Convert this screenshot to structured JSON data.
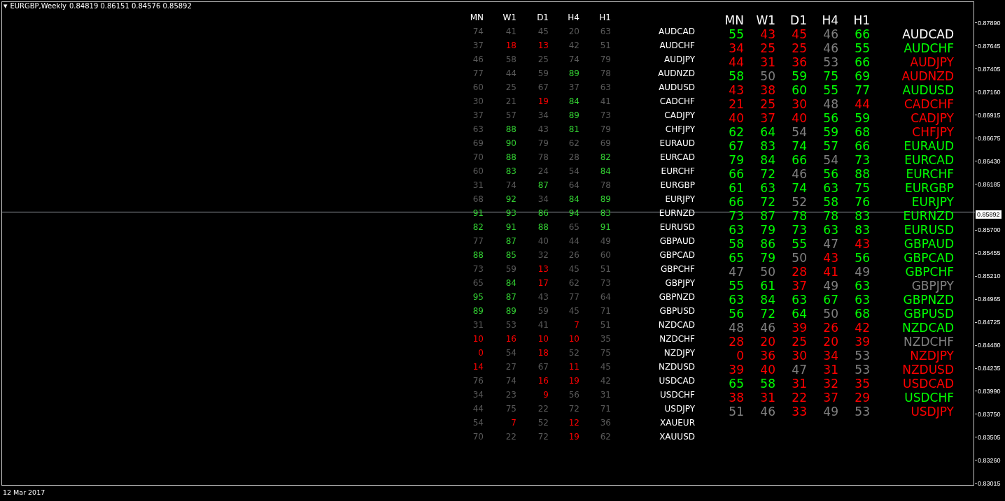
{
  "chart": {
    "menu_glyph": "▼",
    "title": "EURGBP,Weekly",
    "ohlc": "0.84819 0.86151 0.84576 0.85892"
  },
  "price_axis": [
    {
      "kind": "tick",
      "text": "0.87890"
    },
    {
      "kind": "tick",
      "text": "0.87645"
    },
    {
      "kind": "tick",
      "text": "0.87405"
    },
    {
      "kind": "tick",
      "text": "0.87160"
    },
    {
      "kind": "tick",
      "text": "0.86915"
    },
    {
      "kind": "tick",
      "text": "0.86675"
    },
    {
      "kind": "tick",
      "text": "0.86430"
    },
    {
      "kind": "tick",
      "text": "0.86185"
    },
    {
      "kind": "current",
      "text": "0.85892"
    },
    {
      "kind": "tick",
      "text": "0.85700"
    },
    {
      "kind": "tick",
      "text": "0.85455"
    },
    {
      "kind": "tick",
      "text": "0.85210"
    },
    {
      "kind": "tick",
      "text": "0.84965"
    },
    {
      "kind": "tick",
      "text": "0.84725"
    },
    {
      "kind": "tick",
      "text": "0.84480"
    },
    {
      "kind": "tick",
      "text": "0.84235"
    },
    {
      "kind": "tick",
      "text": "0.83990"
    },
    {
      "kind": "tick",
      "text": "0.83750"
    },
    {
      "kind": "tick",
      "text": "0.83505"
    },
    {
      "kind": "tick",
      "text": "0.83260"
    },
    {
      "kind": "tick",
      "text": "0.83015"
    }
  ],
  "time_axis": [
    "12 Mar 2017"
  ],
  "tables": [
    {
      "kind": "small",
      "columns": [
        "MN",
        "W1",
        "D1",
        "H4",
        "H1"
      ],
      "rows": [
        {
          "cells": [
            {
              "text": "74",
              "color": "#5a5a5a"
            },
            {
              "text": "41",
              "color": "#5a5a5a"
            },
            {
              "text": "45",
              "color": "#5a5a5a"
            },
            {
              "text": "20",
              "color": "#5a5a5a"
            },
            {
              "text": "63",
              "color": "#5a5a5a"
            }
          ],
          "symbol": {
            "text": "AUDCAD",
            "color": "#ffffff"
          }
        },
        {
          "cells": [
            {
              "text": "37",
              "color": "#5a5a5a"
            },
            {
              "text": "18",
              "color": "#ff0000"
            },
            {
              "text": "13",
              "color": "#ff0000"
            },
            {
              "text": "42",
              "color": "#5a5a5a"
            },
            {
              "text": "51",
              "color": "#5a5a5a"
            }
          ],
          "symbol": {
            "text": "AUDCHF",
            "color": "#ffffff"
          }
        },
        {
          "cells": [
            {
              "text": "46",
              "color": "#5a5a5a"
            },
            {
              "text": "58",
              "color": "#5a5a5a"
            },
            {
              "text": "25",
              "color": "#5a5a5a"
            },
            {
              "text": "74",
              "color": "#5a5a5a"
            },
            {
              "text": "79",
              "color": "#5a5a5a"
            }
          ],
          "symbol": {
            "text": "AUDJPY",
            "color": "#ffffff"
          }
        },
        {
          "cells": [
            {
              "text": "77",
              "color": "#5a5a5a"
            },
            {
              "text": "44",
              "color": "#5a5a5a"
            },
            {
              "text": "59",
              "color": "#5a5a5a"
            },
            {
              "text": "89",
              "color": "#32cd32"
            },
            {
              "text": "78",
              "color": "#5a5a5a"
            }
          ],
          "symbol": {
            "text": "AUDNZD",
            "color": "#ffffff"
          }
        },
        {
          "cells": [
            {
              "text": "60",
              "color": "#5a5a5a"
            },
            {
              "text": "25",
              "color": "#5a5a5a"
            },
            {
              "text": "67",
              "color": "#5a5a5a"
            },
            {
              "text": "37",
              "color": "#5a5a5a"
            },
            {
              "text": "63",
              "color": "#5a5a5a"
            }
          ],
          "symbol": {
            "text": "AUDUSD",
            "color": "#ffffff"
          }
        },
        {
          "cells": [
            {
              "text": "30",
              "color": "#5a5a5a"
            },
            {
              "text": "21",
              "color": "#5a5a5a"
            },
            {
              "text": "19",
              "color": "#ff0000"
            },
            {
              "text": "84",
              "color": "#32cd32"
            },
            {
              "text": "41",
              "color": "#5a5a5a"
            }
          ],
          "symbol": {
            "text": "CADCHF",
            "color": "#ffffff"
          }
        },
        {
          "cells": [
            {
              "text": "37",
              "color": "#5a5a5a"
            },
            {
              "text": "57",
              "color": "#5a5a5a"
            },
            {
              "text": "34",
              "color": "#5a5a5a"
            },
            {
              "text": "89",
              "color": "#32cd32"
            },
            {
              "text": "73",
              "color": "#5a5a5a"
            }
          ],
          "symbol": {
            "text": "CADJPY",
            "color": "#ffffff"
          }
        },
        {
          "cells": [
            {
              "text": "63",
              "color": "#5a5a5a"
            },
            {
              "text": "88",
              "color": "#32cd32"
            },
            {
              "text": "43",
              "color": "#5a5a5a"
            },
            {
              "text": "81",
              "color": "#32cd32"
            },
            {
              "text": "79",
              "color": "#5a5a5a"
            }
          ],
          "symbol": {
            "text": "CHFJPY",
            "color": "#ffffff"
          }
        },
        {
          "cells": [
            {
              "text": "69",
              "color": "#5a5a5a"
            },
            {
              "text": "90",
              "color": "#32cd32"
            },
            {
              "text": "79",
              "color": "#5a5a5a"
            },
            {
              "text": "62",
              "color": "#5a5a5a"
            },
            {
              "text": "69",
              "color": "#5a5a5a"
            }
          ],
          "symbol": {
            "text": "EURAUD",
            "color": "#ffffff"
          }
        },
        {
          "cells": [
            {
              "text": "70",
              "color": "#5a5a5a"
            },
            {
              "text": "88",
              "color": "#32cd32"
            },
            {
              "text": "78",
              "color": "#5a5a5a"
            },
            {
              "text": "28",
              "color": "#5a5a5a"
            },
            {
              "text": "82",
              "color": "#32cd32"
            }
          ],
          "symbol": {
            "text": "EURCAD",
            "color": "#ffffff"
          }
        },
        {
          "cells": [
            {
              "text": "60",
              "color": "#5a5a5a"
            },
            {
              "text": "83",
              "color": "#32cd32"
            },
            {
              "text": "24",
              "color": "#5a5a5a"
            },
            {
              "text": "54",
              "color": "#5a5a5a"
            },
            {
              "text": "84",
              "color": "#32cd32"
            }
          ],
          "symbol": {
            "text": "EURCHF",
            "color": "#ffffff"
          }
        },
        {
          "cells": [
            {
              "text": "31",
              "color": "#5a5a5a"
            },
            {
              "text": "74",
              "color": "#5a5a5a"
            },
            {
              "text": "87",
              "color": "#32cd32"
            },
            {
              "text": "64",
              "color": "#5a5a5a"
            },
            {
              "text": "78",
              "color": "#5a5a5a"
            }
          ],
          "symbol": {
            "text": "EURGBP",
            "color": "#ffffff"
          }
        },
        {
          "cells": [
            {
              "text": "68",
              "color": "#5a5a5a"
            },
            {
              "text": "92",
              "color": "#32cd32"
            },
            {
              "text": "34",
              "color": "#5a5a5a"
            },
            {
              "text": "84",
              "color": "#32cd32"
            },
            {
              "text": "89",
              "color": "#32cd32"
            }
          ],
          "symbol": {
            "text": "EURJPY",
            "color": "#ffffff"
          }
        },
        {
          "cells": [
            {
              "text": "91",
              "color": "#32cd32"
            },
            {
              "text": "93",
              "color": "#32cd32"
            },
            {
              "text": "86",
              "color": "#32cd32"
            },
            {
              "text": "94",
              "color": "#32cd32"
            },
            {
              "text": "83",
              "color": "#32cd32"
            }
          ],
          "symbol": {
            "text": "EURNZD",
            "color": "#ffffff"
          }
        },
        {
          "cells": [
            {
              "text": "82",
              "color": "#32cd32"
            },
            {
              "text": "91",
              "color": "#32cd32"
            },
            {
              "text": "88",
              "color": "#32cd32"
            },
            {
              "text": "65",
              "color": "#5a5a5a"
            },
            {
              "text": "91",
              "color": "#32cd32"
            }
          ],
          "symbol": {
            "text": "EURUSD",
            "color": "#ffffff"
          }
        },
        {
          "cells": [
            {
              "text": "77",
              "color": "#5a5a5a"
            },
            {
              "text": "87",
              "color": "#32cd32"
            },
            {
              "text": "40",
              "color": "#5a5a5a"
            },
            {
              "text": "44",
              "color": "#5a5a5a"
            },
            {
              "text": "49",
              "color": "#5a5a5a"
            }
          ],
          "symbol": {
            "text": "GBPAUD",
            "color": "#ffffff"
          }
        },
        {
          "cells": [
            {
              "text": "88",
              "color": "#32cd32"
            },
            {
              "text": "85",
              "color": "#32cd32"
            },
            {
              "text": "32",
              "color": "#5a5a5a"
            },
            {
              "text": "26",
              "color": "#5a5a5a"
            },
            {
              "text": "60",
              "color": "#5a5a5a"
            }
          ],
          "symbol": {
            "text": "GBPCAD",
            "color": "#ffffff"
          }
        },
        {
          "cells": [
            {
              "text": "73",
              "color": "#5a5a5a"
            },
            {
              "text": "59",
              "color": "#5a5a5a"
            },
            {
              "text": "13",
              "color": "#ff0000"
            },
            {
              "text": "45",
              "color": "#5a5a5a"
            },
            {
              "text": "51",
              "color": "#5a5a5a"
            }
          ],
          "symbol": {
            "text": "GBPCHF",
            "color": "#ffffff"
          }
        },
        {
          "cells": [
            {
              "text": "65",
              "color": "#5a5a5a"
            },
            {
              "text": "84",
              "color": "#32cd32"
            },
            {
              "text": "17",
              "color": "#ff0000"
            },
            {
              "text": "62",
              "color": "#5a5a5a"
            },
            {
              "text": "73",
              "color": "#5a5a5a"
            }
          ],
          "symbol": {
            "text": "GBPJPY",
            "color": "#ffffff"
          }
        },
        {
          "cells": [
            {
              "text": "95",
              "color": "#32cd32"
            },
            {
              "text": "87",
              "color": "#32cd32"
            },
            {
              "text": "43",
              "color": "#5a5a5a"
            },
            {
              "text": "77",
              "color": "#5a5a5a"
            },
            {
              "text": "64",
              "color": "#5a5a5a"
            }
          ],
          "symbol": {
            "text": "GBPNZD",
            "color": "#ffffff"
          }
        },
        {
          "cells": [
            {
              "text": "89",
              "color": "#32cd32"
            },
            {
              "text": "89",
              "color": "#32cd32"
            },
            {
              "text": "59",
              "color": "#5a5a5a"
            },
            {
              "text": "45",
              "color": "#5a5a5a"
            },
            {
              "text": "71",
              "color": "#5a5a5a"
            }
          ],
          "symbol": {
            "text": "GBPUSD",
            "color": "#ffffff"
          }
        },
        {
          "cells": [
            {
              "text": "31",
              "color": "#5a5a5a"
            },
            {
              "text": "53",
              "color": "#5a5a5a"
            },
            {
              "text": "41",
              "color": "#5a5a5a"
            },
            {
              "text": "7",
              "color": "#ff0000"
            },
            {
              "text": "51",
              "color": "#5a5a5a"
            }
          ],
          "symbol": {
            "text": "NZDCAD",
            "color": "#ffffff"
          }
        },
        {
          "cells": [
            {
              "text": "10",
              "color": "#ff0000"
            },
            {
              "text": "16",
              "color": "#ff0000"
            },
            {
              "text": "10",
              "color": "#ff0000"
            },
            {
              "text": "10",
              "color": "#ff0000"
            },
            {
              "text": "35",
              "color": "#5a5a5a"
            }
          ],
          "symbol": {
            "text": "NZDCHF",
            "color": "#ffffff"
          }
        },
        {
          "cells": [
            {
              "text": "0",
              "color": "#ff0000"
            },
            {
              "text": "54",
              "color": "#5a5a5a"
            },
            {
              "text": "18",
              "color": "#ff0000"
            },
            {
              "text": "52",
              "color": "#5a5a5a"
            },
            {
              "text": "75",
              "color": "#5a5a5a"
            }
          ],
          "symbol": {
            "text": "NZDJPY",
            "color": "#ffffff"
          }
        },
        {
          "cells": [
            {
              "text": "14",
              "color": "#ff0000"
            },
            {
              "text": "27",
              "color": "#5a5a5a"
            },
            {
              "text": "67",
              "color": "#5a5a5a"
            },
            {
              "text": "11",
              "color": "#ff0000"
            },
            {
              "text": "45",
              "color": "#5a5a5a"
            }
          ],
          "symbol": {
            "text": "NZDUSD",
            "color": "#ffffff"
          }
        },
        {
          "cells": [
            {
              "text": "76",
              "color": "#5a5a5a"
            },
            {
              "text": "74",
              "color": "#5a5a5a"
            },
            {
              "text": "16",
              "color": "#ff0000"
            },
            {
              "text": "19",
              "color": "#ff0000"
            },
            {
              "text": "42",
              "color": "#5a5a5a"
            }
          ],
          "symbol": {
            "text": "USDCAD",
            "color": "#ffffff"
          }
        },
        {
          "cells": [
            {
              "text": "34",
              "color": "#5a5a5a"
            },
            {
              "text": "23",
              "color": "#5a5a5a"
            },
            {
              "text": "9",
              "color": "#ff0000"
            },
            {
              "text": "56",
              "color": "#5a5a5a"
            },
            {
              "text": "31",
              "color": "#5a5a5a"
            }
          ],
          "symbol": {
            "text": "USDCHF",
            "color": "#ffffff"
          }
        },
        {
          "cells": [
            {
              "text": "44",
              "color": "#5a5a5a"
            },
            {
              "text": "75",
              "color": "#5a5a5a"
            },
            {
              "text": "22",
              "color": "#5a5a5a"
            },
            {
              "text": "72",
              "color": "#5a5a5a"
            },
            {
              "text": "71",
              "color": "#5a5a5a"
            }
          ],
          "symbol": {
            "text": "USDJPY",
            "color": "#ffffff"
          }
        },
        {
          "cells": [
            {
              "text": "54",
              "color": "#5a5a5a"
            },
            {
              "text": "7",
              "color": "#ff0000"
            },
            {
              "text": "52",
              "color": "#5a5a5a"
            },
            {
              "text": "12",
              "color": "#ff0000"
            },
            {
              "text": "36",
              "color": "#5a5a5a"
            }
          ],
          "symbol": {
            "text": "XAUEUR",
            "color": "#ffffff"
          }
        },
        {
          "cells": [
            {
              "text": "70",
              "color": "#5a5a5a"
            },
            {
              "text": "22",
              "color": "#5a5a5a"
            },
            {
              "text": "72",
              "color": "#5a5a5a"
            },
            {
              "text": "19",
              "color": "#ff0000"
            },
            {
              "text": "62",
              "color": "#5a5a5a"
            }
          ],
          "symbol": {
            "text": "XAUUSD",
            "color": "#ffffff"
          }
        }
      ]
    },
    {
      "kind": "large",
      "columns": [
        "MN",
        "W1",
        "D1",
        "H4",
        "H1"
      ],
      "rows": [
        {
          "cells": [
            {
              "text": "55",
              "color": "#00ff00"
            },
            {
              "text": "43",
              "color": "#ff0000"
            },
            {
              "text": "45",
              "color": "#ff0000"
            },
            {
              "text": "46",
              "color": "#808080"
            },
            {
              "text": "66",
              "color": "#00ff00"
            }
          ],
          "symbol": {
            "text": "AUDCAD",
            "color": "#ffffff"
          }
        },
        {
          "cells": [
            {
              "text": "34",
              "color": "#ff0000"
            },
            {
              "text": "25",
              "color": "#ff0000"
            },
            {
              "text": "25",
              "color": "#ff0000"
            },
            {
              "text": "46",
              "color": "#808080"
            },
            {
              "text": "55",
              "color": "#00ff00"
            }
          ],
          "symbol": {
            "text": "AUDCHF",
            "color": "#00ff00"
          }
        },
        {
          "cells": [
            {
              "text": "44",
              "color": "#ff0000"
            },
            {
              "text": "31",
              "color": "#ff0000"
            },
            {
              "text": "36",
              "color": "#ff0000"
            },
            {
              "text": "53",
              "color": "#808080"
            },
            {
              "text": "66",
              "color": "#00ff00"
            }
          ],
          "symbol": {
            "text": "AUDJPY",
            "color": "#ff0000"
          }
        },
        {
          "cells": [
            {
              "text": "58",
              "color": "#00ff00"
            },
            {
              "text": "50",
              "color": "#808080"
            },
            {
              "text": "59",
              "color": "#00ff00"
            },
            {
              "text": "75",
              "color": "#00ff00"
            },
            {
              "text": "69",
              "color": "#00ff00"
            }
          ],
          "symbol": {
            "text": "AUDNZD",
            "color": "#ff0000"
          }
        },
        {
          "cells": [
            {
              "text": "43",
              "color": "#ff0000"
            },
            {
              "text": "38",
              "color": "#ff0000"
            },
            {
              "text": "60",
              "color": "#00ff00"
            },
            {
              "text": "55",
              "color": "#00ff00"
            },
            {
              "text": "77",
              "color": "#00ff00"
            }
          ],
          "symbol": {
            "text": "AUDUSD",
            "color": "#00ff00"
          }
        },
        {
          "cells": [
            {
              "text": "21",
              "color": "#ff0000"
            },
            {
              "text": "25",
              "color": "#ff0000"
            },
            {
              "text": "30",
              "color": "#ff0000"
            },
            {
              "text": "48",
              "color": "#808080"
            },
            {
              "text": "44",
              "color": "#ff0000"
            }
          ],
          "symbol": {
            "text": "CADCHF",
            "color": "#ff0000"
          }
        },
        {
          "cells": [
            {
              "text": "40",
              "color": "#ff0000"
            },
            {
              "text": "37",
              "color": "#ff0000"
            },
            {
              "text": "40",
              "color": "#ff0000"
            },
            {
              "text": "56",
              "color": "#00ff00"
            },
            {
              "text": "59",
              "color": "#00ff00"
            }
          ],
          "symbol": {
            "text": "CADJPY",
            "color": "#ff0000"
          }
        },
        {
          "cells": [
            {
              "text": "62",
              "color": "#00ff00"
            },
            {
              "text": "64",
              "color": "#00ff00"
            },
            {
              "text": "54",
              "color": "#808080"
            },
            {
              "text": "59",
              "color": "#00ff00"
            },
            {
              "text": "68",
              "color": "#00ff00"
            }
          ],
          "symbol": {
            "text": "CHFJPY",
            "color": "#ff0000"
          }
        },
        {
          "cells": [
            {
              "text": "67",
              "color": "#00ff00"
            },
            {
              "text": "83",
              "color": "#00ff00"
            },
            {
              "text": "74",
              "color": "#00ff00"
            },
            {
              "text": "57",
              "color": "#00ff00"
            },
            {
              "text": "66",
              "color": "#00ff00"
            }
          ],
          "symbol": {
            "text": "EURAUD",
            "color": "#00ff00"
          }
        },
        {
          "cells": [
            {
              "text": "79",
              "color": "#00ff00"
            },
            {
              "text": "84",
              "color": "#00ff00"
            },
            {
              "text": "66",
              "color": "#00ff00"
            },
            {
              "text": "54",
              "color": "#808080"
            },
            {
              "text": "73",
              "color": "#00ff00"
            }
          ],
          "symbol": {
            "text": "EURCAD",
            "color": "#00ff00"
          }
        },
        {
          "cells": [
            {
              "text": "66",
              "color": "#00ff00"
            },
            {
              "text": "72",
              "color": "#00ff00"
            },
            {
              "text": "46",
              "color": "#808080"
            },
            {
              "text": "56",
              "color": "#00ff00"
            },
            {
              "text": "88",
              "color": "#00ff00"
            }
          ],
          "symbol": {
            "text": "EURCHF",
            "color": "#00ff00"
          }
        },
        {
          "cells": [
            {
              "text": "61",
              "color": "#00ff00"
            },
            {
              "text": "63",
              "color": "#00ff00"
            },
            {
              "text": "74",
              "color": "#00ff00"
            },
            {
              "text": "63",
              "color": "#00ff00"
            },
            {
              "text": "75",
              "color": "#00ff00"
            }
          ],
          "symbol": {
            "text": "EURGBP",
            "color": "#00ff00"
          }
        },
        {
          "cells": [
            {
              "text": "66",
              "color": "#00ff00"
            },
            {
              "text": "72",
              "color": "#00ff00"
            },
            {
              "text": "52",
              "color": "#808080"
            },
            {
              "text": "58",
              "color": "#00ff00"
            },
            {
              "text": "76",
              "color": "#00ff00"
            }
          ],
          "symbol": {
            "text": "EURJPY",
            "color": "#00ff00"
          }
        },
        {
          "cells": [
            {
              "text": "73",
              "color": "#00ff00"
            },
            {
              "text": "87",
              "color": "#00ff00"
            },
            {
              "text": "78",
              "color": "#00ff00"
            },
            {
              "text": "78",
              "color": "#00ff00"
            },
            {
              "text": "83",
              "color": "#00ff00"
            }
          ],
          "symbol": {
            "text": "EURNZD",
            "color": "#00ff00"
          }
        },
        {
          "cells": [
            {
              "text": "63",
              "color": "#00ff00"
            },
            {
              "text": "79",
              "color": "#00ff00"
            },
            {
              "text": "73",
              "color": "#00ff00"
            },
            {
              "text": "63",
              "color": "#00ff00"
            },
            {
              "text": "83",
              "color": "#00ff00"
            }
          ],
          "symbol": {
            "text": "EURUSD",
            "color": "#00ff00"
          }
        },
        {
          "cells": [
            {
              "text": "58",
              "color": "#00ff00"
            },
            {
              "text": "86",
              "color": "#00ff00"
            },
            {
              "text": "55",
              "color": "#00ff00"
            },
            {
              "text": "47",
              "color": "#808080"
            },
            {
              "text": "43",
              "color": "#ff0000"
            }
          ],
          "symbol": {
            "text": "GBPAUD",
            "color": "#00ff00"
          }
        },
        {
          "cells": [
            {
              "text": "65",
              "color": "#00ff00"
            },
            {
              "text": "79",
              "color": "#00ff00"
            },
            {
              "text": "50",
              "color": "#808080"
            },
            {
              "text": "43",
              "color": "#ff0000"
            },
            {
              "text": "56",
              "color": "#00ff00"
            }
          ],
          "symbol": {
            "text": "GBPCAD",
            "color": "#00ff00"
          }
        },
        {
          "cells": [
            {
              "text": "47",
              "color": "#808080"
            },
            {
              "text": "50",
              "color": "#808080"
            },
            {
              "text": "28",
              "color": "#ff0000"
            },
            {
              "text": "41",
              "color": "#ff0000"
            },
            {
              "text": "49",
              "color": "#808080"
            }
          ],
          "symbol": {
            "text": "GBPCHF",
            "color": "#00ff00"
          }
        },
        {
          "cells": [
            {
              "text": "55",
              "color": "#00ff00"
            },
            {
              "text": "61",
              "color": "#00ff00"
            },
            {
              "text": "37",
              "color": "#ff0000"
            },
            {
              "text": "49",
              "color": "#808080"
            },
            {
              "text": "63",
              "color": "#00ff00"
            }
          ],
          "symbol": {
            "text": "GBPJPY",
            "color": "#808080"
          }
        },
        {
          "cells": [
            {
              "text": "63",
              "color": "#00ff00"
            },
            {
              "text": "84",
              "color": "#00ff00"
            },
            {
              "text": "63",
              "color": "#00ff00"
            },
            {
              "text": "67",
              "color": "#00ff00"
            },
            {
              "text": "63",
              "color": "#00ff00"
            }
          ],
          "symbol": {
            "text": "GBPNZD",
            "color": "#00ff00"
          }
        },
        {
          "cells": [
            {
              "text": "56",
              "color": "#00ff00"
            },
            {
              "text": "72",
              "color": "#00ff00"
            },
            {
              "text": "64",
              "color": "#00ff00"
            },
            {
              "text": "50",
              "color": "#808080"
            },
            {
              "text": "68",
              "color": "#00ff00"
            }
          ],
          "symbol": {
            "text": "GBPUSD",
            "color": "#00ff00"
          }
        },
        {
          "cells": [
            {
              "text": "48",
              "color": "#808080"
            },
            {
              "text": "46",
              "color": "#808080"
            },
            {
              "text": "39",
              "color": "#ff0000"
            },
            {
              "text": "26",
              "color": "#ff0000"
            },
            {
              "text": "42",
              "color": "#ff0000"
            }
          ],
          "symbol": {
            "text": "NZDCAD",
            "color": "#00ff00"
          }
        },
        {
          "cells": [
            {
              "text": "28",
              "color": "#ff0000"
            },
            {
              "text": "20",
              "color": "#ff0000"
            },
            {
              "text": "25",
              "color": "#ff0000"
            },
            {
              "text": "20",
              "color": "#ff0000"
            },
            {
              "text": "39",
              "color": "#ff0000"
            }
          ],
          "symbol": {
            "text": "NZDCHF",
            "color": "#808080"
          }
        },
        {
          "cells": [
            {
              "text": "0",
              "color": "#ff0000"
            },
            {
              "text": "36",
              "color": "#ff0000"
            },
            {
              "text": "30",
              "color": "#ff0000"
            },
            {
              "text": "34",
              "color": "#ff0000"
            },
            {
              "text": "53",
              "color": "#808080"
            }
          ],
          "symbol": {
            "text": "NZDJPY",
            "color": "#ff0000"
          }
        },
        {
          "cells": [
            {
              "text": "39",
              "color": "#ff0000"
            },
            {
              "text": "40",
              "color": "#ff0000"
            },
            {
              "text": "47",
              "color": "#808080"
            },
            {
              "text": "31",
              "color": "#ff0000"
            },
            {
              "text": "53",
              "color": "#808080"
            }
          ],
          "symbol": {
            "text": "NZDUSD",
            "color": "#ff0000"
          }
        },
        {
          "cells": [
            {
              "text": "65",
              "color": "#00ff00"
            },
            {
              "text": "58",
              "color": "#00ff00"
            },
            {
              "text": "31",
              "color": "#ff0000"
            },
            {
              "text": "32",
              "color": "#ff0000"
            },
            {
              "text": "35",
              "color": "#ff0000"
            }
          ],
          "symbol": {
            "text": "USDCAD",
            "color": "#ff0000"
          }
        },
        {
          "cells": [
            {
              "text": "38",
              "color": "#ff0000"
            },
            {
              "text": "31",
              "color": "#ff0000"
            },
            {
              "text": "22",
              "color": "#ff0000"
            },
            {
              "text": "37",
              "color": "#ff0000"
            },
            {
              "text": "29",
              "color": "#ff0000"
            }
          ],
          "symbol": {
            "text": "USDCHF",
            "color": "#00ff00"
          }
        },
        {
          "cells": [
            {
              "text": "51",
              "color": "#808080"
            },
            {
              "text": "46",
              "color": "#808080"
            },
            {
              "text": "33",
              "color": "#ff0000"
            },
            {
              "text": "49",
              "color": "#808080"
            },
            {
              "text": "53",
              "color": "#808080"
            }
          ],
          "symbol": {
            "text": "USDJPY",
            "color": "#ff0000"
          }
        }
      ]
    }
  ]
}
